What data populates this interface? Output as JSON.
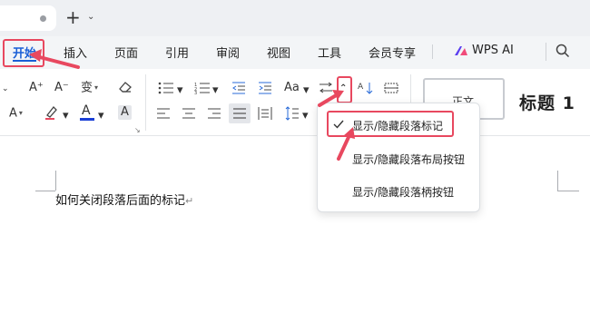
{
  "titlebar": {
    "new_tab_symbol": "+"
  },
  "menu": {
    "items": [
      "开始",
      "插入",
      "页面",
      "引用",
      "审阅",
      "视图",
      "工具",
      "会员专享"
    ],
    "ai_label": "WPS AI"
  },
  "toolbar": {
    "font_grow": "A⁺",
    "font_shrink": "A⁻",
    "phonetic": "变",
    "font_color_letter": "A",
    "text_shade": "A",
    "change_case": "Aa"
  },
  "styles": {
    "normal_label": "正文",
    "heading1_label": "标题 1"
  },
  "document": {
    "text": "如何关闭段落后面的标记",
    "paragraph_mark": "↵"
  },
  "dropdown": {
    "items": [
      "显示/隐藏段落标记",
      "显示/隐藏段落布局按钮",
      "显示/隐藏段落柄按钮"
    ],
    "checked_index": 0
  },
  "colors": {
    "accent_blue": "#1a5fd6",
    "annotation_red": "#e8485f",
    "font_color_bar": "#1a3fd6"
  }
}
